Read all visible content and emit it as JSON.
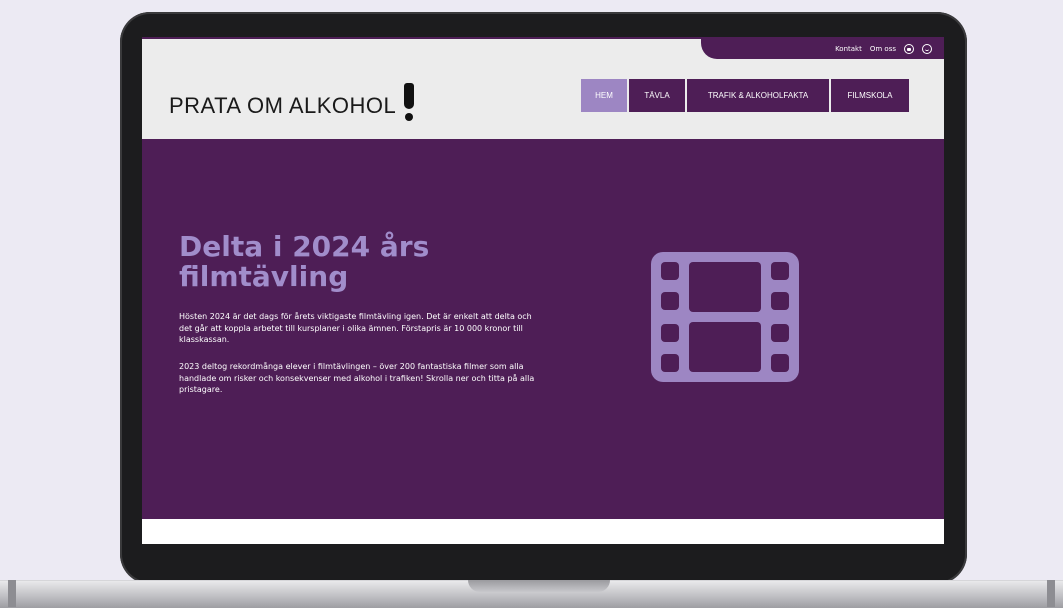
{
  "topbar": {
    "links": [
      "Kontakt",
      "Om oss"
    ],
    "icons": [
      "youtube-icon",
      "smiley-icon"
    ]
  },
  "logo": {
    "text": "PRATA OM ALKOHOL"
  },
  "nav": {
    "items": [
      {
        "label": "HEM",
        "active": true
      },
      {
        "label": "TÄVLA",
        "active": false
      },
      {
        "label": "TRAFIK & ALKOHOLFAKTA",
        "active": false
      },
      {
        "label": "FILMSKOLA",
        "active": false
      }
    ]
  },
  "hero": {
    "title": "Delta i 2024 års filmtävling",
    "paragraph1": "Hösten 2024 är det dags för årets viktigaste filmtävling igen. Det är enkelt att delta och det går att koppla arbetet till kursplaner i olika ämnen. Förstapris är 10 000 kronor till klasskassan.",
    "paragraph2": "2023 deltog rekordmånga elever i filmtävlingen – över 200 fantastiska filmer som alla handlade om risker och konsekvenser med alkohol i trafiken! Skrolla ner och titta på alla pristagare.",
    "icon": "film-strip-icon"
  },
  "colors": {
    "brand_purple": "#4e1e56",
    "accent_lavender": "#9d86c3",
    "header_bg": "#ececec"
  }
}
